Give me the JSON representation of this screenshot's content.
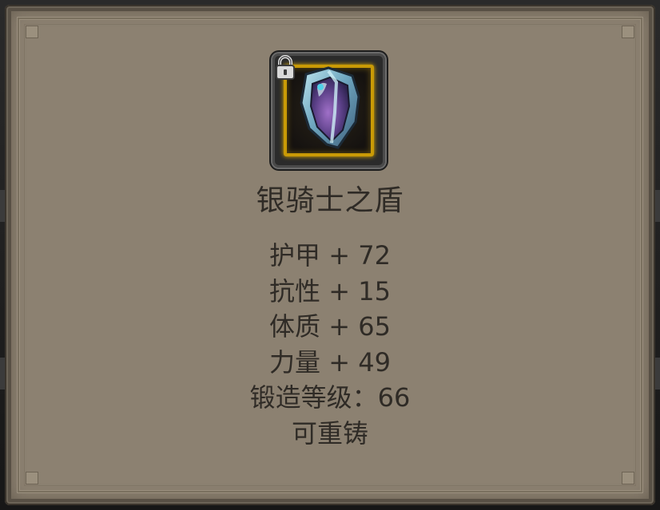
{
  "item": {
    "name": "银骑士之盾",
    "icon": "shield-icon",
    "locked": true,
    "lock_icon": "lock-icon",
    "frame_color": "#c99a06"
  },
  "stats": [
    "护甲 + 72",
    "抗性 + 15",
    "体质 + 65",
    "力量 + 49",
    "锻造等级：66",
    "可重铸"
  ],
  "colors": {
    "panel": "#8c8171",
    "text": "#2f2b26"
  }
}
